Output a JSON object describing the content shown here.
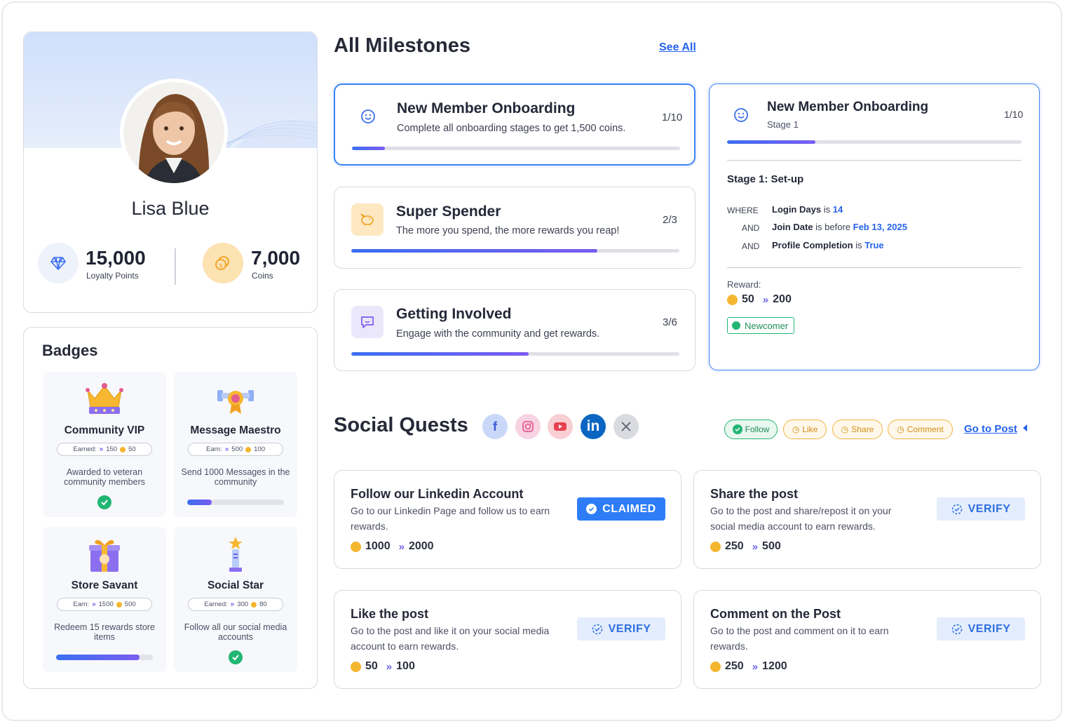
{
  "profile": {
    "name": "Lisa Blue",
    "loyalty_points": "15,000",
    "loyalty_label": "Loyalty Points",
    "coins": "7,000",
    "coins_label": "Coins"
  },
  "badges": {
    "title": "Badges",
    "items": [
      {
        "title": "Community VIP",
        "earn_label": "Earned:",
        "xp": "150",
        "coins": "50",
        "desc": "Awarded to veteran community members",
        "status": "complete"
      },
      {
        "title": "Message Maestro",
        "earn_label": "Earn:",
        "xp": "500",
        "coins": "100",
        "desc": "Send 1000 Messages in the community",
        "status": "progress",
        "progress": 0.25
      },
      {
        "title": "Store Savant",
        "earn_label": "Earn:",
        "xp": "1500",
        "coins": "500",
        "desc": "Redeem 15 rewards store items",
        "status": "progress",
        "progress": 0.86
      },
      {
        "title": "Social Star",
        "earn_label": "Earned:",
        "xp": "300",
        "coins": "80",
        "desc": "Follow all our social media accounts",
        "status": "complete"
      }
    ]
  },
  "milestones": {
    "title": "All Milestones",
    "see_all": "See All",
    "items": [
      {
        "title": "New Member Onboarding",
        "desc": "Complete all onboarding stages to get 1,500 coins.",
        "count": "1/10",
        "progress": 0.1,
        "icon": "smiley-icon"
      },
      {
        "title": "Super Spender",
        "desc": "The more you spend, the more rewards you reap!",
        "count": "2/3",
        "progress": 0.75,
        "icon": "piggy-bank-icon"
      },
      {
        "title": "Getting Involved",
        "desc": "Engage with the community and get rewards.",
        "count": "3/6",
        "progress": 0.54,
        "icon": "chat-icon"
      }
    ]
  },
  "detail": {
    "title": "New Member Onboarding",
    "stage": "Stage 1",
    "count": "1/10",
    "progress": 0.3,
    "stage_title": "Stage 1: Set-up",
    "conditions": [
      {
        "keyword": "WHERE",
        "field": "Login Days",
        "op": "is",
        "value": "14"
      },
      {
        "keyword": "AND",
        "field": "Join Date",
        "op": "is before",
        "value": "Feb 13, 2025"
      },
      {
        "keyword": "AND",
        "field": "Profile Completion",
        "op": "is",
        "value": "True"
      }
    ],
    "reward_label": "Reward:",
    "reward_coins": "50",
    "reward_xp": "200",
    "tag": "Newcomer"
  },
  "social": {
    "title": "Social Quests",
    "platforms": [
      "facebook-icon",
      "instagram-icon",
      "youtube-icon",
      "linkedin-icon",
      "x-icon"
    ],
    "filters": [
      "Follow",
      "Like",
      "Share",
      "Comment"
    ],
    "go_to_post": "Go to Post",
    "quests": [
      {
        "title": "Follow our Linkedin Account",
        "desc": "Go to our Linkedin Page and follow us to earn rewards.",
        "coins": "1000",
        "xp": "2000",
        "button": "CLAIMED"
      },
      {
        "title": "Share the post",
        "desc": "Go to the post and share/repost it on your social media account to earn rewards.",
        "coins": "250",
        "xp": "500",
        "button": "VERIFY"
      },
      {
        "title": "Like the post",
        "desc": "Go to the post and like it on your social media account to earn rewards.",
        "coins": "50",
        "xp": "100",
        "button": "VERIFY"
      },
      {
        "title": "Comment on the Post",
        "desc": "Go to the post and comment on it to earn rewards.",
        "coins": "250",
        "xp": "1200",
        "button": "VERIFY"
      }
    ]
  },
  "colors": {
    "accent": "#2f7df6",
    "coin": "#f5b62f",
    "xp": "#6d62e6",
    "success": "#22b573"
  }
}
